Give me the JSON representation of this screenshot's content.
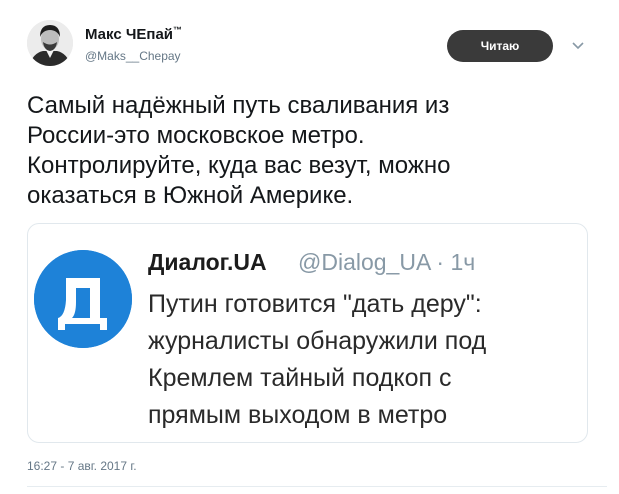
{
  "author": {
    "name": "Макс ЧЕпай",
    "name_mark": "™",
    "handle": "@Maks__Chepay"
  },
  "follow_button": {
    "label": "Читаю"
  },
  "menu": {
    "icon": "chevron-down-icon"
  },
  "tweet": {
    "lines": [
      "Самый надёжный путь сваливания из",
      "России-это московское метро.",
      "Контролируйте, куда вас везут, можно",
      "оказаться в Южной Америке."
    ]
  },
  "quoted": {
    "logo_letter": "Д",
    "logo_color": "#1e82d8",
    "name": "Диалог.UA",
    "meta": "@Dialog_UA · 1ч",
    "lines": [
      "Путин готовится \"дать деру\":",
      "журналисты обнаружили под",
      "Кремлем тайный подкоп с",
      "прямым выходом в метро"
    ]
  },
  "timestamp": "16:27 - 7 авг. 2017 г."
}
